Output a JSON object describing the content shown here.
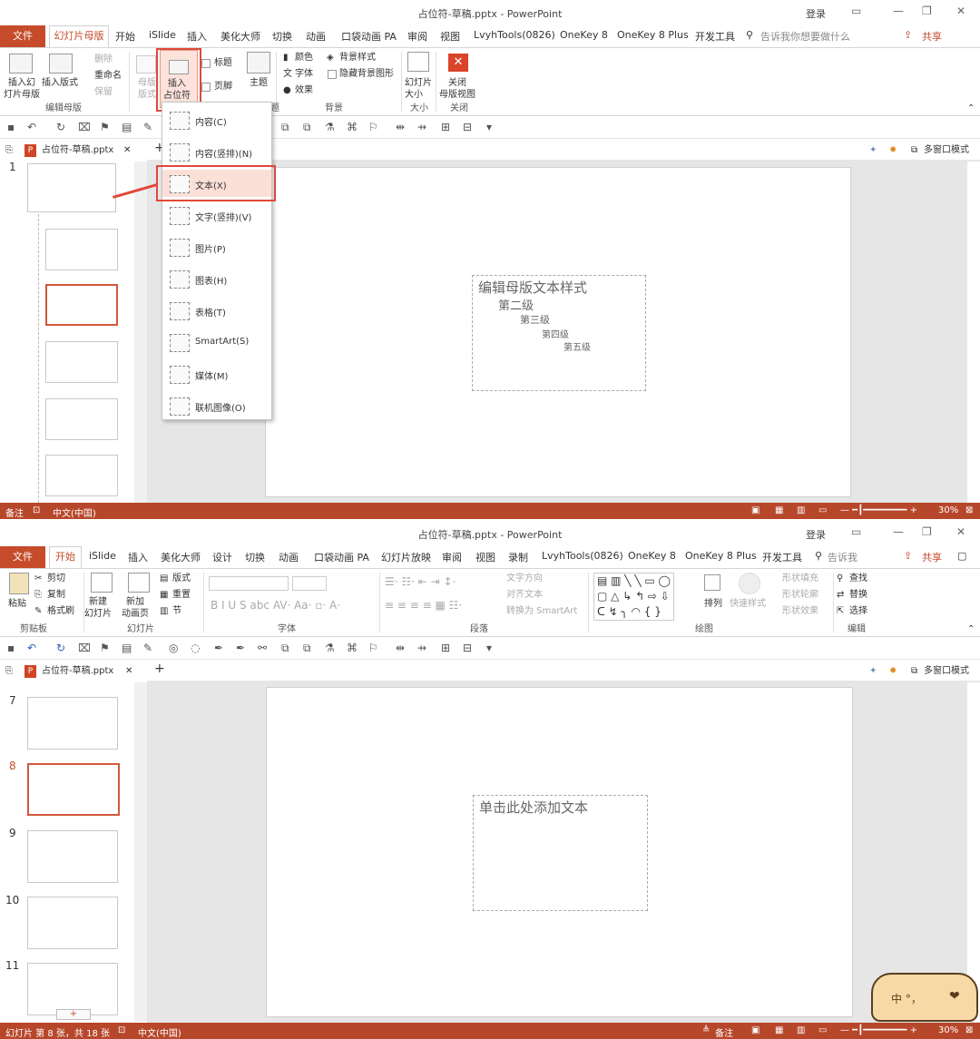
{
  "top": {
    "title": "占位符-草稿.pptx - PowerPoint",
    "login": "登录",
    "tabs": [
      "文件",
      "幻灯片母版",
      "开始",
      "iSlide",
      "插入",
      "美化大师",
      "切换",
      "动画",
      "口袋动画 PA",
      "审阅",
      "视图",
      "LvyhTools(0826)",
      "OneKey 8",
      "OneKey 8 Plus",
      "开发工具"
    ],
    "tellme": "告诉我你想要做什么",
    "share": "共享",
    "ribbon": {
      "insert_slide_master": "插入幻\n灯片母版",
      "insert_layout": "插入版式",
      "delete": "删除",
      "rename": "重命名",
      "preserve": "保留",
      "master_layout": "母版\n版式",
      "insert_placeholder": "插入\n占位符",
      "title_check": "标题",
      "footer_check": "页脚",
      "themes": "主题",
      "colors": "颜色",
      "fonts": "字体",
      "effects": "效果",
      "bg_styles": "背景样式",
      "hide_bg": "隐藏背景图形",
      "slide_size": "幻灯片\n大小",
      "close_master": "关闭\n母版视图",
      "group_edit_master": "编辑母版",
      "group_bg": "背景",
      "group_size": "大小",
      "group_close": "关闭",
      "group_theme_tail": "题"
    },
    "doc_tab": "占位符-草稿.pptx",
    "multiwin": "多窗口模式",
    "slide_number": "1",
    "dropdown": [
      "内容(C)",
      "内容(竖排)(N)",
      "文本(X)",
      "文字(竖排)(V)",
      "图片(P)",
      "图表(H)",
      "表格(T)",
      "SmartArt(S)",
      "媒体(M)",
      "联机图像(O)"
    ],
    "placeholder_levels": [
      "编辑母版文本样式",
      "第二级",
      "第三级",
      "第四级",
      "第五级"
    ],
    "status": {
      "notes": "备注",
      "lang": "中文(中国)",
      "zoom": "30%"
    }
  },
  "bottom": {
    "title": "占位符-草稿.pptx - PowerPoint",
    "login": "登录",
    "tabs": [
      "文件",
      "开始",
      "iSlide",
      "插入",
      "美化大师",
      "设计",
      "切换",
      "动画",
      "口袋动画 PA",
      "幻灯片放映",
      "审阅",
      "视图",
      "录制",
      "LvyhTools(0826)",
      "OneKey 8",
      "OneKey 8 Plus",
      "开发工具"
    ],
    "tellme": "告诉我",
    "share": "共享",
    "ribbon": {
      "paste": "粘贴",
      "cut": "剪切",
      "copy": "复制",
      "format_painter": "格式刷",
      "new_slide": "新建\n幻灯片",
      "new_anim_page": "新加\n动画页",
      "layout": "版式",
      "reset": "重置",
      "section": "节",
      "text_dir": "文字方向",
      "align_text": "对齐文本",
      "to_smartart": "转换为 SmartArt",
      "arrange": "排列",
      "quick_styles": "快速样式",
      "shape_fill": "形状填充",
      "shape_outline": "形状轮廓",
      "shape_effects": "形状效果",
      "find": "查找",
      "replace": "替换",
      "select": "选择",
      "group_clipboard": "剪贴板",
      "group_slides": "幻灯片",
      "group_font": "字体",
      "group_paragraph": "段落",
      "group_drawing": "绘图",
      "group_editing": "编辑"
    },
    "doc_tab": "占位符-草稿.pptx",
    "multiwin": "多窗口模式",
    "slide_numbers": [
      "7",
      "8",
      "9",
      "10",
      "11"
    ],
    "placeholder_text": "单击此处添加文本",
    "add_button": "+",
    "status": {
      "slide_info": "幻灯片 第 8 张，共 18 张",
      "lang": "中文(中国)",
      "notes": "备注",
      "zoom": "30%"
    },
    "ime": "中 °，"
  }
}
